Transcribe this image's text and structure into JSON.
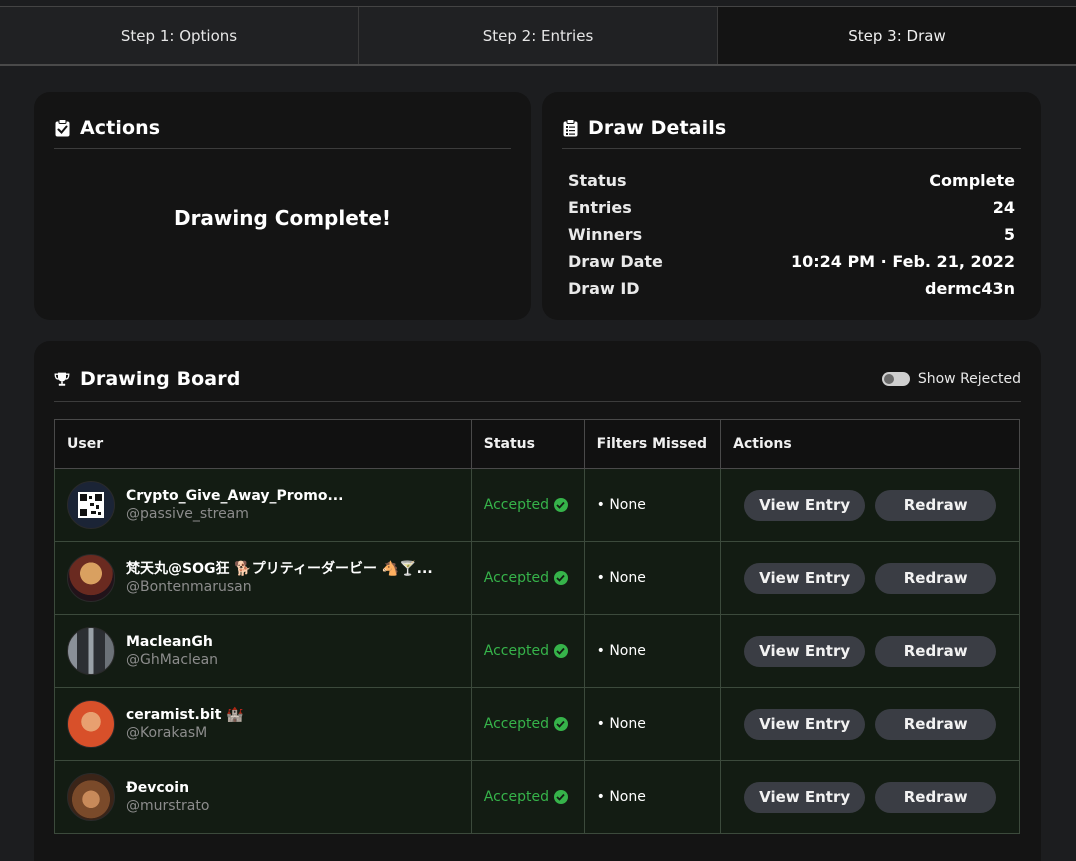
{
  "steps": [
    {
      "label": "Step 1: Options"
    },
    {
      "label": "Step 2: Entries"
    },
    {
      "label": "Step 3: Draw"
    }
  ],
  "actions": {
    "title": "Actions",
    "message": "Drawing Complete!"
  },
  "details": {
    "title": "Draw Details",
    "rows": [
      {
        "label": "Status",
        "value": "Complete"
      },
      {
        "label": "Entries",
        "value": "24"
      },
      {
        "label": "Winners",
        "value": "5"
      },
      {
        "label": "Draw Date",
        "value": "10:24 PM · Feb. 21, 2022"
      },
      {
        "label": "Draw ID",
        "value": "dermc43n"
      }
    ]
  },
  "board": {
    "title": "Drawing Board",
    "toggle_label": "Show Rejected",
    "columns": [
      "User",
      "Status",
      "Filters Missed",
      "Actions"
    ],
    "view_label": "View Entry",
    "redraw_label": "Redraw",
    "rows": [
      {
        "name": "Crypto_Give_Away_Promo...",
        "handle": "@passive_stream",
        "status": "Accepted",
        "filters": "• None",
        "avatar_color": "#1b2436"
      },
      {
        "name": "梵天丸@SOG狂 🐕プリティーダービー 🐴🍸...",
        "handle": "@Bontenmarusan",
        "status": "Accepted",
        "filters": "• None",
        "avatar_color": "#7a3a2a"
      },
      {
        "name": "MacleanGh",
        "handle": "@GhMaclean",
        "status": "Accepted",
        "filters": "• None",
        "avatar_color": "#4a4e52"
      },
      {
        "name": "ceramist.bit 🏰",
        "handle": "@KorakasM",
        "status": "Accepted",
        "filters": "• None",
        "avatar_color": "#d8502a"
      },
      {
        "name": "Ðevcoin",
        "handle": "@murstrato",
        "status": "Accepted",
        "filters": "• None",
        "avatar_color": "#6a3e22"
      }
    ]
  },
  "colors": {
    "accent_green": "#36b34a",
    "button_bg": "#3a3d44",
    "card_bg": "#141414"
  }
}
